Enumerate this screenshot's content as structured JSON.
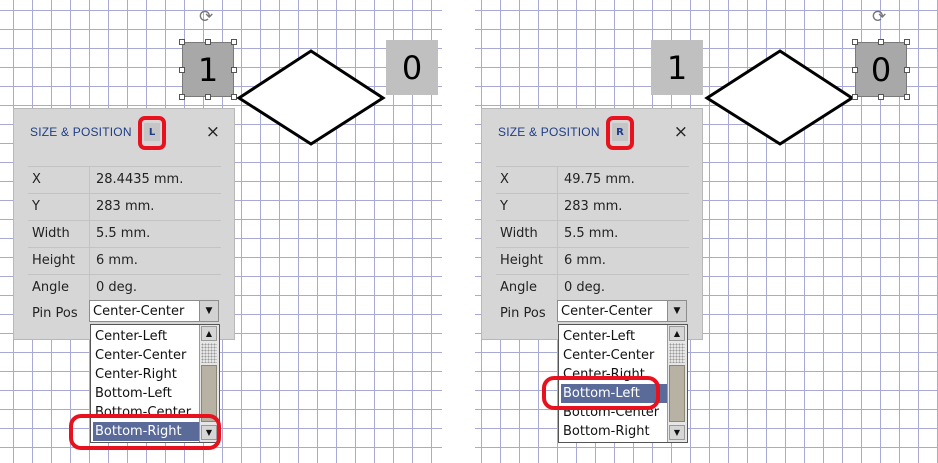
{
  "panels": [
    {
      "title": "SIZE & POSITION",
      "badge": "L",
      "close": "×",
      "fields": [
        {
          "label": "X",
          "value": "28.4435 mm."
        },
        {
          "label": "Y",
          "value": "283 mm."
        },
        {
          "label": "Width",
          "value": "5.5 mm."
        },
        {
          "label": "Height",
          "value": "6 mm."
        },
        {
          "label": "Angle",
          "value": "0 deg."
        }
      ],
      "pin_label": "Pin Pos",
      "pin_value": "Center-Center",
      "dropdown_items": [
        "Center-Left",
        "Center-Center",
        "Center-Right",
        "Bottom-Left",
        "Bottom-Center",
        "Bottom-Right"
      ],
      "highlighted": "Bottom-Right",
      "shape_left": "1",
      "shape_right": "0"
    },
    {
      "title": "SIZE & POSITION",
      "badge": "R",
      "close": "×",
      "fields": [
        {
          "label": "X",
          "value": "49.75 mm."
        },
        {
          "label": "Y",
          "value": "283 mm."
        },
        {
          "label": "Width",
          "value": "5.5 mm."
        },
        {
          "label": "Height",
          "value": "6 mm."
        },
        {
          "label": "Angle",
          "value": "0 deg."
        }
      ],
      "pin_label": "Pin Pos",
      "pin_value": "Center-Center",
      "dropdown_items": [
        "Center-Left",
        "Center-Center",
        "Center-Right",
        "Bottom-Left",
        "Bottom-Center",
        "Bottom-Right"
      ],
      "highlighted": "Bottom-Left",
      "shape_left": "1",
      "shape_right": "0"
    }
  ],
  "colors": {
    "accent": "#1f3d86",
    "callout": "#e8121e",
    "highlight": "#5a6b99"
  }
}
